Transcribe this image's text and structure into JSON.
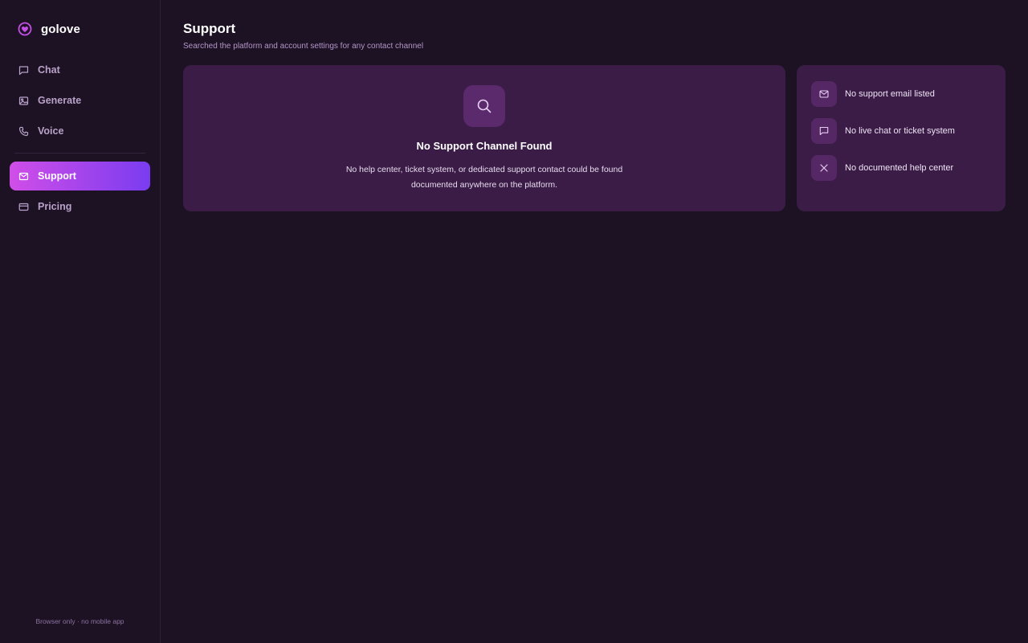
{
  "brand": {
    "name": "golove",
    "logo_icon": "heart-icon",
    "accent": "#c44ee6"
  },
  "sidebar": {
    "items": [
      {
        "label": "Chat",
        "icon": "chat-icon",
        "active": false
      },
      {
        "label": "Generate",
        "icon": "image-icon",
        "active": false
      },
      {
        "label": "Voice",
        "icon": "phone-icon",
        "active": false
      },
      {
        "label": "Support",
        "icon": "mail-icon",
        "active": true
      },
      {
        "label": "Pricing",
        "icon": "card-icon",
        "active": false
      }
    ],
    "footer": "Browser only · no mobile app"
  },
  "page": {
    "title": "Support",
    "subtitle": "Searched the platform and account settings for any contact channel"
  },
  "empty_state": {
    "icon": "search-icon",
    "title": "No Support Channel Found",
    "description": "No help center, ticket system, or dedicated support contact could be found documented anywhere on the platform."
  },
  "status_list": [
    {
      "icon": "mail-icon",
      "label": "No support email listed"
    },
    {
      "icon": "chat-icon",
      "label": "No live chat or ticket system"
    },
    {
      "icon": "close-icon",
      "label": "No documented help center"
    }
  ],
  "colors": {
    "background": "#1d1224",
    "card": "#3a1c46",
    "active_gradient_start": "#d04ee8",
    "active_gradient_end": "#7a3cf0"
  }
}
